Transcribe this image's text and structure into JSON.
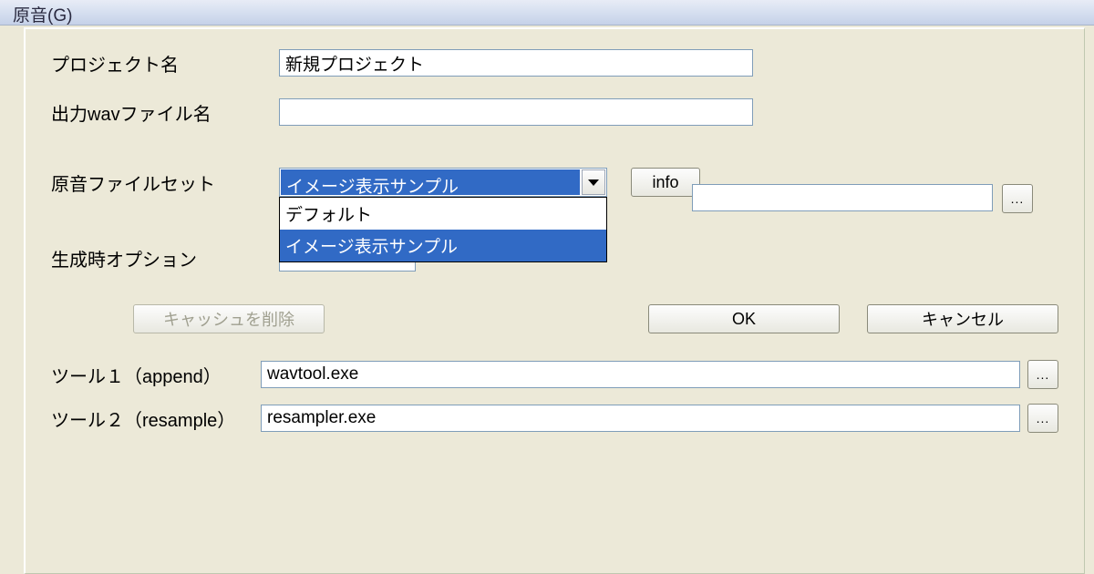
{
  "title": "原音(G)",
  "labels": {
    "project_name": "プロジェクト名",
    "output_wav": "出力wavファイル名",
    "voice_fileset": "原音ファイルセット",
    "gen_option": "生成時オプション",
    "tool1": "ツール１（append）",
    "tool2": "ツール２（resample）"
  },
  "values": {
    "project_name": "新規プロジェクト",
    "output_wav": "",
    "gen_option": "",
    "tool1": "wavtool.exe",
    "tool2": "resampler.exe",
    "fileset_extra": ""
  },
  "combo": {
    "selected": "イメージ表示サンプル",
    "options": {
      "0": "デフォルト",
      "1": "イメージ表示サンプル"
    }
  },
  "buttons": {
    "info": "info",
    "browse": "...",
    "clear_cache": "キャッシュを削除",
    "ok": "OK",
    "cancel": "キャンセル"
  }
}
